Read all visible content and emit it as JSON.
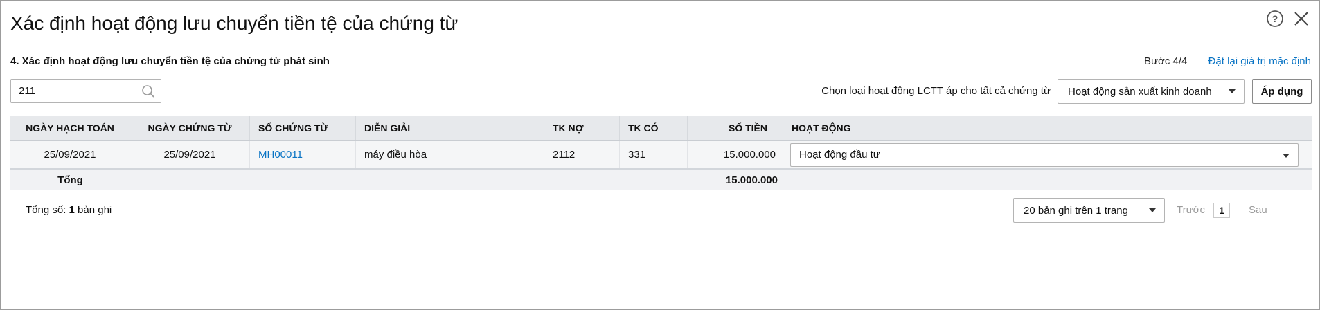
{
  "dialog": {
    "title": "Xác định hoạt động lưu chuyển tiền tệ của chứng từ",
    "subtitle": "4. Xác định hoạt động lưu chuyển tiền tệ của chứng từ phát sinh",
    "step": "Bước 4/4",
    "reset_label": "Đặt lại giá trị mặc định"
  },
  "search": {
    "value": "211",
    "placeholder": ""
  },
  "apply_all": {
    "label": "Chọn loại hoạt động LCTT áp cho tất cả chứng từ",
    "selected": "Hoạt động sản xuất kinh doanh",
    "apply_button": "Áp dụng"
  },
  "table": {
    "columns": [
      "NGÀY HẠCH TOÁN",
      "NGÀY CHỨNG TỪ",
      "SỐ CHỨNG TỪ",
      "DIỄN GIẢI",
      "TK NỢ",
      "TK CÓ",
      "SỐ TIỀN",
      "HOẠT ĐỘNG"
    ],
    "rows": [
      {
        "posting_date": "25/09/2021",
        "doc_date": "25/09/2021",
        "doc_no": "MH00011",
        "description": "máy điều hòa",
        "debit_account": "2112",
        "credit_account": "331",
        "amount": "15.000.000",
        "activity": "Hoạt động đầu tư"
      }
    ],
    "total_label": "Tổng",
    "total_amount": "15.000.000"
  },
  "footer": {
    "total_prefix": "Tổng số: ",
    "total_count": "1",
    "total_suffix": " bản ghi",
    "page_size": "20 bản ghi trên 1 trang",
    "prev": "Trước",
    "page": "1",
    "next": "Sau"
  },
  "icons": {
    "help": "help-circle-icon",
    "close": "close-icon",
    "search": "search-icon",
    "dropdown": "caret-down-icon"
  },
  "colors": {
    "link": "#0a74c4",
    "header_bg": "#e7e9ec",
    "row_bg": "#f5f6f7"
  }
}
